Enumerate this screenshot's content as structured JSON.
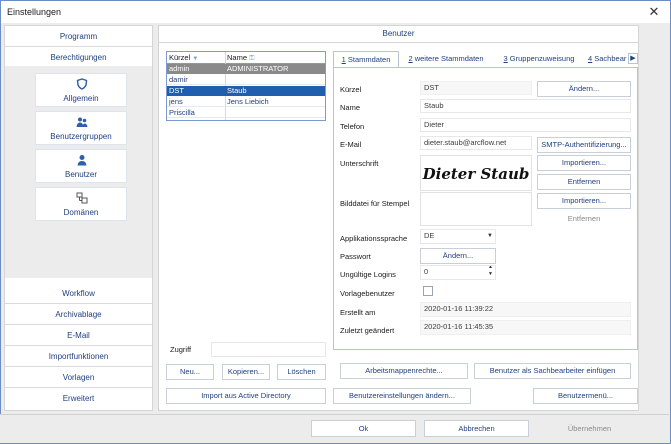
{
  "window": {
    "title": "Einstellungen",
    "close_glyph": "✕"
  },
  "sidebar": {
    "top_links": [
      "Programm",
      "Berechtigungen"
    ],
    "big_items": [
      {
        "label": "Allgemein",
        "icon": "shield-icon"
      },
      {
        "label": "Benutzergruppen",
        "icon": "users-icon"
      },
      {
        "label": "Benutzer",
        "icon": "user-icon"
      },
      {
        "label": "Domänen",
        "icon": "domain-icon"
      }
    ],
    "bottom_links": [
      "Workflow",
      "Archivablage",
      "E-Mail",
      "Importfunktionen",
      "Vorlagen",
      "Erweitert"
    ]
  },
  "main": {
    "header": "Benutzer",
    "user_list": {
      "columns": [
        "Kürzel",
        "Name"
      ],
      "rows": [
        {
          "kuerzel": "admin",
          "name": "ADMINISTRATOR",
          "state": "grey"
        },
        {
          "kuerzel": "damir",
          "name": "",
          "state": "normal"
        },
        {
          "kuerzel": "DST",
          "name": "Staub",
          "state": "selected"
        },
        {
          "kuerzel": "jens",
          "name": "Jens Liebich",
          "state": "normal"
        },
        {
          "kuerzel": "Priscilla",
          "name": "",
          "state": "normal"
        }
      ]
    },
    "zugriff_label": "Zugriff",
    "zugriff_value": "",
    "list_buttons": {
      "neu": "Neu...",
      "kopieren": "Kopieren...",
      "loeschen": "Löschen"
    },
    "import_ad": "Import aus Active Directory",
    "tabs": [
      {
        "num": "1",
        "label": " Stammdaten"
      },
      {
        "num": "2",
        "label": " weitere Stammdaten"
      },
      {
        "num": "3",
        "label": " Gruppenzuweisung"
      },
      {
        "num": "4",
        "label": " Sachbear"
      }
    ],
    "tab_scroll_glyph": "▶",
    "form": {
      "kuerzel_label": "Kürzel",
      "kuerzel_value": "DST",
      "name_label": "Name",
      "name_value": "Staub",
      "telefon_label": "Telefon",
      "telefon_value": "Dieter",
      "email_label": "E-Mail",
      "email_value": "dieter.staub@arcflow.net",
      "unterschrift_label": "Unterschrift",
      "unterschrift_value": "Dieter Staub",
      "bilddatei_label": "Bilddatei für Stempel",
      "sprache_label": "Applikationssprache",
      "sprache_value": "DE",
      "passwort_label": "Passwort",
      "logins_label": "Ungültige Logins",
      "logins_value": "0",
      "vorlage_label": "Vorlagebenutzer",
      "vorlage_checked": false,
      "erstellt_label": "Erstellt am",
      "erstellt_value": "2020-01-16 11:39:22",
      "geaendert_label": "Zuletzt geändert",
      "geaendert_value": "2020-01-16 11:45:35"
    },
    "form_buttons": {
      "aendern": "Ändern...",
      "smtp": "SMTP-Authentifizierung...",
      "importieren1": "Importieren...",
      "entfernen1": "Entfernen",
      "importieren2": "Importieren...",
      "entfernen2": "Entfernen",
      "passwort_aendern": "Ändern..."
    },
    "action_buttons": {
      "arbeitsmappen": "Arbeitsmappenrechte...",
      "sachbearbeiter": "Benutzer als Sachbearbeiter einfügen",
      "benutzereinstellungen": "Benutzereinstellungen ändern...",
      "benutzermenue": "Benutzermenü..."
    }
  },
  "footer": {
    "ok": "Ok",
    "abbrechen": "Abbrechen",
    "uebernehmen": "Übernehmen"
  },
  "colors": {
    "selected_row": "#1f5fae",
    "grey_row": "#8a8a8a",
    "accent": "#1f3f7f"
  }
}
